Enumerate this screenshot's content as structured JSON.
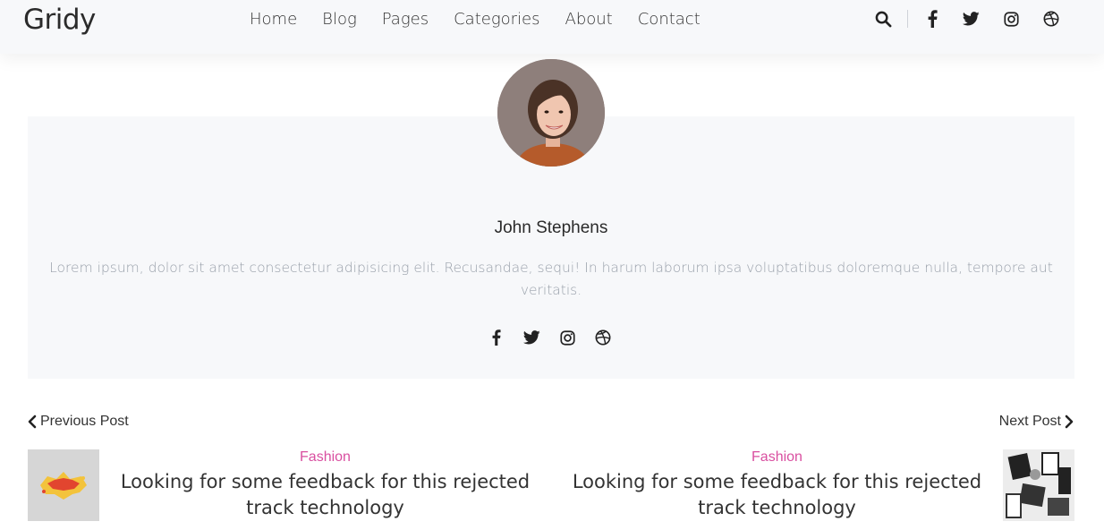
{
  "header": {
    "logo": "Gridy",
    "nav": [
      "Home",
      "Blog",
      "Pages",
      "Categories",
      "About",
      "Contact"
    ],
    "icons": [
      "search-icon",
      "facebook-icon",
      "twitter-icon",
      "instagram-icon",
      "dribbble-icon"
    ]
  },
  "author": {
    "name": "John Stephens",
    "bio": "Lorem ipsum, dolor sit amet consectetur adipisicing elit. Recusandae, sequi! In harum laborum ipsa voluptatibus doloremque nulla, tempore aut veritatis.",
    "social_icons": [
      "facebook-icon",
      "twitter-icon",
      "instagram-icon",
      "dribbble-icon"
    ]
  },
  "post_nav": {
    "previous_label": "Previous Post",
    "next_label": "Next Post",
    "previous_post": {
      "category": "Fashion",
      "title": "Looking for some feedback for this rejected track technology"
    },
    "next_post": {
      "category": "Fashion",
      "title": "Looking for some feedback for this rejected track technology"
    }
  },
  "colors": {
    "accent": "#d94fa0",
    "card_bg": "#f7f8fa",
    "muted_text": "#9aa1ab"
  }
}
